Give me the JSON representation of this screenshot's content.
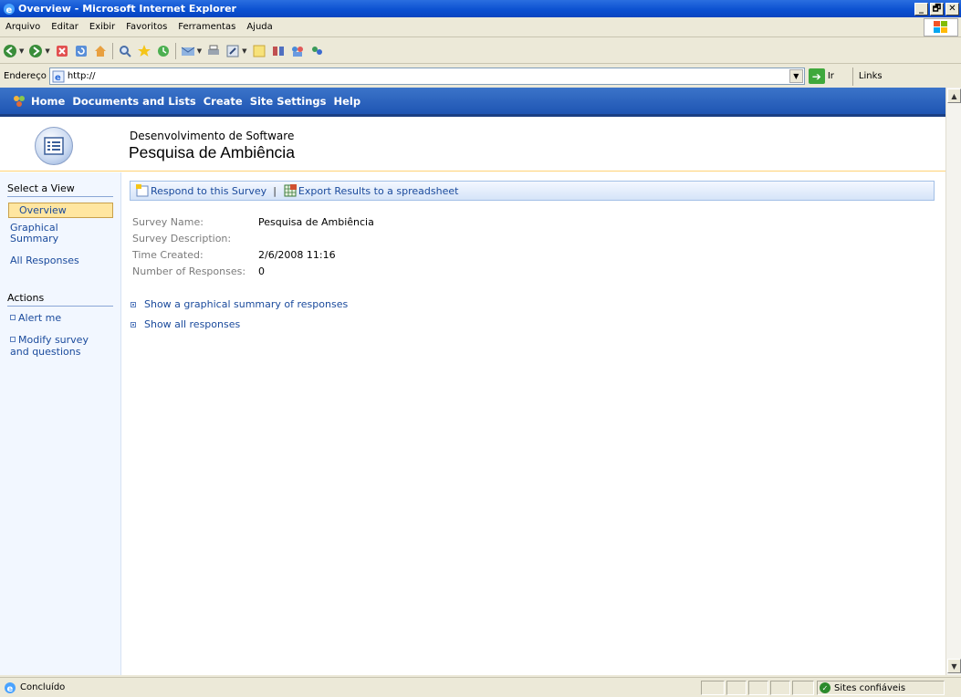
{
  "window": {
    "title": "Overview - Microsoft Internet Explorer",
    "controls": [
      "_",
      "🗗",
      "✕"
    ]
  },
  "menu": [
    "Arquivo",
    "Editar",
    "Exibir",
    "Favoritos",
    "Ferramentas",
    "Ajuda"
  ],
  "address": {
    "label": "Endereço",
    "value": "http://",
    "go_label": "Ir",
    "links_label": "Links"
  },
  "sp_nav": [
    "Home",
    "Documents and Lists",
    "Create",
    "Site Settings",
    "Help"
  ],
  "site": {
    "name": "Desenvolvimento de Software",
    "title": "Pesquisa de Ambiência"
  },
  "left_nav": {
    "view_heading": "Select a View",
    "views": [
      "Overview",
      "Graphical Summary",
      "All Responses"
    ],
    "actions_heading": "Actions",
    "actions": [
      "Alert me",
      "Modify survey and questions"
    ]
  },
  "action_bar": {
    "respond": "Respond to this Survey",
    "separator": "|",
    "export": "Export Results to a spreadsheet"
  },
  "survey": {
    "name_label": "Survey Name:",
    "name_value": "Pesquisa de Ambiência",
    "desc_label": "Survey Description:",
    "desc_value": "",
    "time_label": "Time Created:",
    "time_value": "2/6/2008 11:16",
    "count_label": "Number of Responses:",
    "count_value": "0"
  },
  "links": [
    "Show a graphical summary of responses",
    "Show all responses"
  ],
  "status": {
    "text": "Concluído",
    "zone": "Sites confiáveis"
  },
  "colors": {
    "nav_blue": "#1f55b3",
    "link_blue": "#1a4a9c",
    "selected_view": "#ffe6a0"
  }
}
